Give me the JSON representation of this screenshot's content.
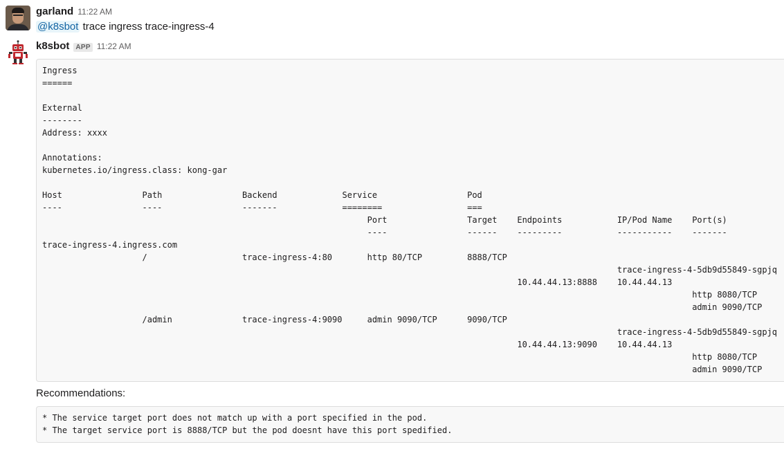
{
  "messages": [
    {
      "user": "garland",
      "time": "11:22 AM",
      "mention": "@k8sbot",
      "text": " trace ingress trace-ingress-4"
    },
    {
      "user": "k8sbot",
      "badge": "APP",
      "time": "11:22 AM",
      "code": "Ingress\n======\n\nExternal\n--------\nAddress: xxxx\n\nAnnotations:\nkubernetes.io/ingress.class: kong-gar\n\nHost                Path                Backend             Service                  Pod\n----                ----                -------             ========                 ===\n                                                                 Port                Target    Endpoints           IP/Pod Name    Port(s)\n                                                                 ----                ------    ---------           -----------    -------\ntrace-ingress-4.ingress.com\n                    /                   trace-ingress-4:80       http 80/TCP         8888/TCP\n                                                                                                                   trace-ingress-4-5db9d55849-sgpjq\n                                                                                               10.44.44.13:8888    10.44.44.13\n                                                                                                                                  http 8080/TCP\n                                                                                                                                  admin 9090/TCP\n                    /admin              trace-ingress-4:9090     admin 9090/TCP      9090/TCP\n                                                                                                                   trace-ingress-4-5db9d55849-sgpjq\n                                                                                               10.44.44.13:9090    10.44.44.13\n                                                                                                                                  http 8080/TCP\n                                                                                                                                  admin 9090/TCP",
      "section_label": "Recommendations:",
      "recommendations": "* The service target port does not match up with a port specified in the pod.\n* The target service port is 8888/TCP but the pod doesnt have this port spedified."
    }
  ],
  "icons": {
    "user_avatar": "user-avatar-photo",
    "bot_avatar": "robot-icon"
  },
  "colors": {
    "mention_text": "#1264a3",
    "mention_bg": "#e8f5fa",
    "code_bg": "#f8f8f8",
    "code_border": "#dddddd",
    "bot_red": "#c0282e"
  }
}
